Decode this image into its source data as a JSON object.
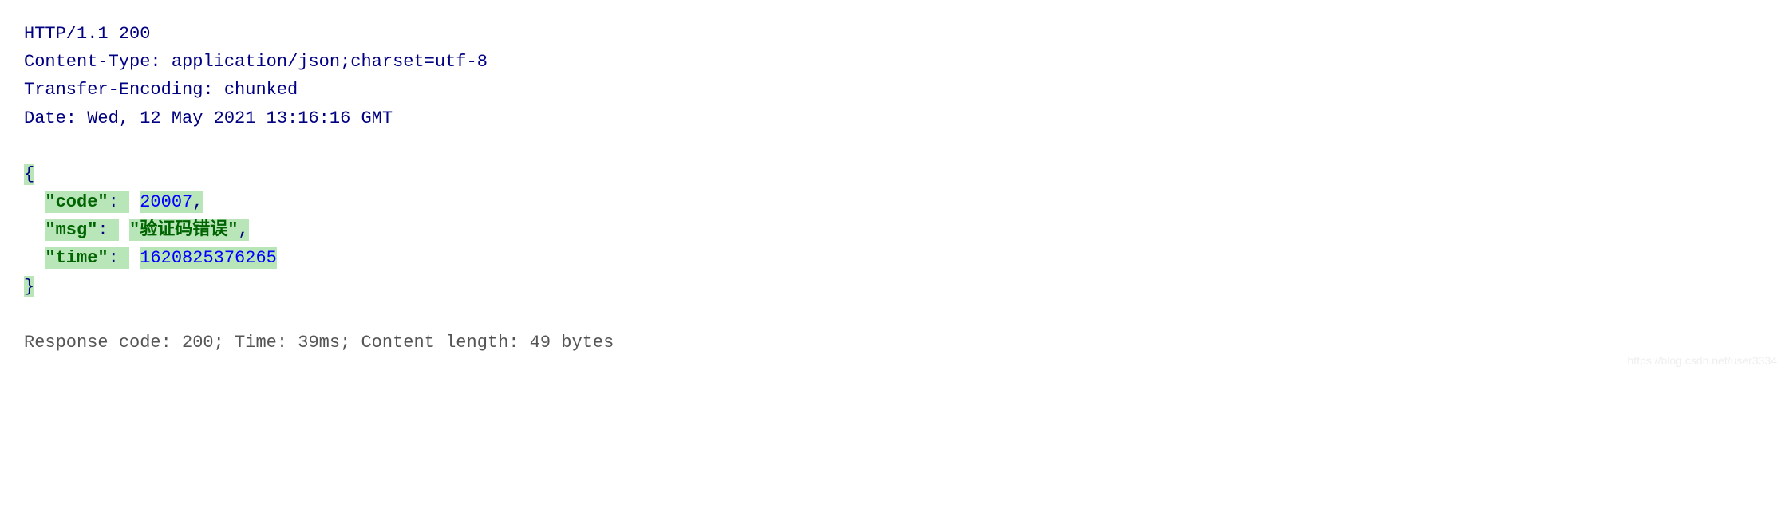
{
  "http": {
    "status_line": "HTTP/1.1 200",
    "headers": {
      "content_type_label": "Content-Type: ",
      "content_type_value": "application/json;charset=utf-8",
      "transfer_encoding_label": "Transfer-Encoding: ",
      "transfer_encoding_value": "chunked",
      "date_label": "Date: ",
      "date_value": "Wed, 12 May 2021 13:16:16 GMT"
    }
  },
  "json_body": {
    "open_brace": "{",
    "close_brace": "}",
    "entries": [
      {
        "key": "\"code\"",
        "colon": ": ",
        "value": "20007",
        "comma": ","
      },
      {
        "key": "\"msg\"",
        "colon": ": ",
        "value": "\"验证码错误\"",
        "comma": ","
      },
      {
        "key": "\"time\"",
        "colon": ": ",
        "value": "1620825376265",
        "comma": ""
      }
    ]
  },
  "summary": {
    "text": "Response code: 200; Time: 39ms; Content length: 49 bytes"
  },
  "watermark": "https://blog.csdn.net/user3334"
}
